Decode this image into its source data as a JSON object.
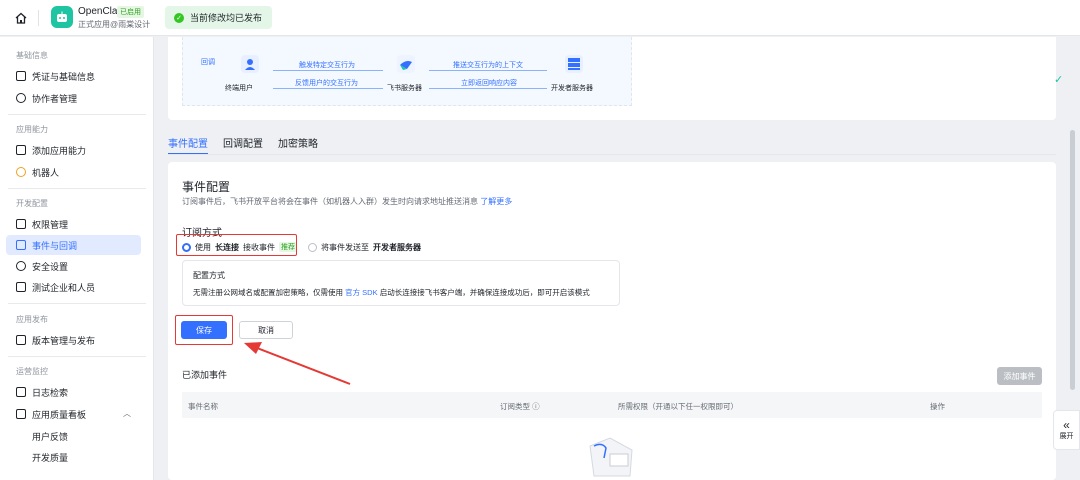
{
  "topbar": {
    "app_name": "OpenClaw",
    "app_badge": "已启用",
    "app_sub": "正式应用@雨棠设计",
    "publish_tip": "当前修改均已发布"
  },
  "sidebar": {
    "groups": {
      "basic": "基础信息",
      "ability": "应用能力",
      "dev": "开发配置",
      "release": "应用发布",
      "ops": "运营监控"
    },
    "items": {
      "credentials": "凭证与基础信息",
      "collaborators": "协作者管理",
      "add_ability": "添加应用能力",
      "bot": "机器人",
      "permissions": "权限管理",
      "events": "事件与回调",
      "security": "安全设置",
      "test_company": "测试企业和人员",
      "version": "版本管理与发布",
      "logs": "日志检索",
      "quality": "应用质量看板",
      "feedback": "用户反馈",
      "dev_quality": "开发质量"
    }
  },
  "diagram": {
    "callback_label": "回调",
    "user": "终端用户",
    "feishu_server": "飞书服务器",
    "dev_server": "开发者服务器",
    "arrow_1": "触发特定交互行为",
    "arrow_2": "反馈用户的交互行为",
    "arrow_3": "推送交互行为的上下文",
    "arrow_4": "立即返回响应内容"
  },
  "tabs": {
    "event_config": "事件配置",
    "callback_config": "回调配置",
    "encryption": "加密策略"
  },
  "card": {
    "title": "事件配置",
    "desc": "订阅事件后，飞书开放平台将会在事件（如机器人入群）发生时向请求地址推送消息",
    "learn_more": "了解更多",
    "subscribe_title": "订阅方式",
    "option_long_prefix": "使用",
    "option_long_bold": "长连接",
    "option_long_suffix": "接收事件",
    "recommend": "推荐",
    "option_server_prefix": "将事件发送至",
    "option_server_bold": "开发者服务器",
    "config_title": "配置方式",
    "config_desc_1": "无需注册公网域名或配置加密策略，仅需使用",
    "config_desc_link": "官方 SDK",
    "config_desc_2": "启动长连接接飞书客户端，并确保连接成功后，即可开启该模式",
    "save": "保存",
    "cancel": "取消",
    "added_title": "已添加事件",
    "add_event": "添加事件",
    "columns": {
      "name": "事件名称",
      "type": "订阅类型 ⓘ",
      "perm": "所需权限（开通以下任一权限即可）",
      "action": "操作"
    }
  },
  "expand_label": "展开",
  "colors": {
    "accent": "#3370ff",
    "highlight": "#e53935",
    "success": "#34c724"
  }
}
